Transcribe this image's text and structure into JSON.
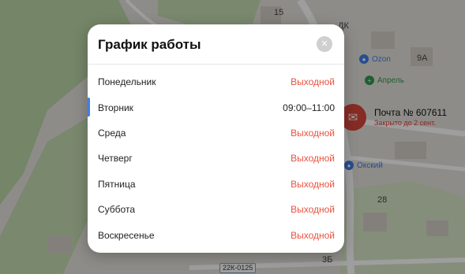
{
  "map": {
    "labels": [
      "15",
      "ДК",
      "Ozon",
      "9А",
      "Апрель",
      "Окский",
      "28",
      "3Б"
    ],
    "post_marker": {
      "title": "Почта № 607611",
      "status": "Закрыто до 2 сент."
    },
    "road_badge": "22К-0125"
  },
  "modal": {
    "title": "График работы",
    "close_icon": "close-icon",
    "schedule": [
      {
        "day": "Понедельник",
        "hours": "Выходной",
        "off": true,
        "current": false
      },
      {
        "day": "Вторник",
        "hours": "09:00–11:00",
        "off": false,
        "current": true
      },
      {
        "day": "Среда",
        "hours": "Выходной",
        "off": true,
        "current": false
      },
      {
        "day": "Четверг",
        "hours": "Выходной",
        "off": true,
        "current": false
      },
      {
        "day": "Пятница",
        "hours": "Выходной",
        "off": true,
        "current": false
      },
      {
        "day": "Суббота",
        "hours": "Выходной",
        "off": true,
        "current": false
      },
      {
        "day": "Воскресенье",
        "hours": "Выходной",
        "off": true,
        "current": false
      }
    ]
  },
  "colors": {
    "closed": "#e8523f",
    "current_indicator": "#3f7fe8",
    "post_marker": "#d9473a"
  }
}
